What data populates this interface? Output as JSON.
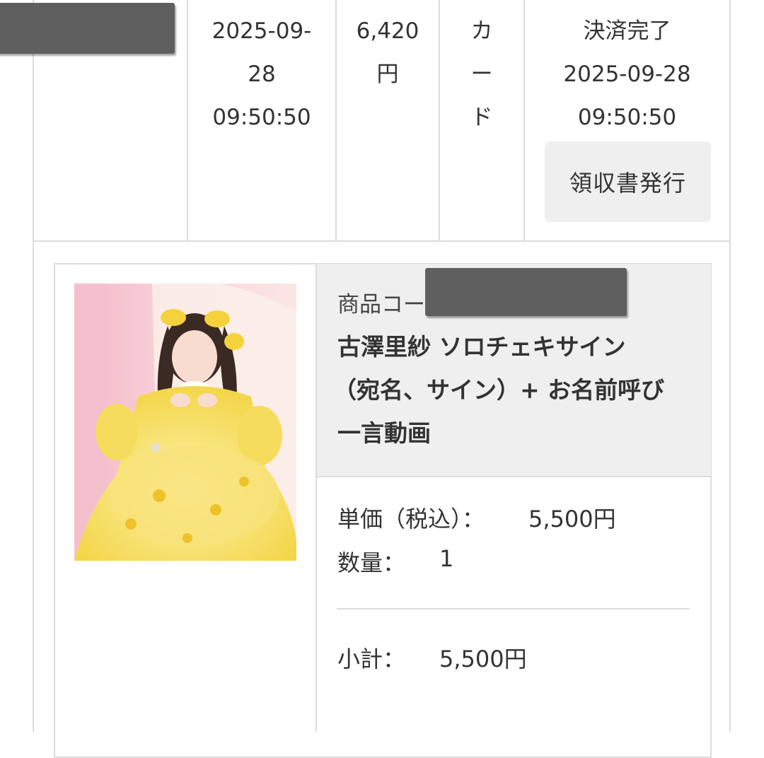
{
  "order_row": {
    "order_datetime_lines": [
      "2025-09-",
      "28",
      "09:50:50"
    ],
    "amount_lines": [
      "6,420",
      "円"
    ],
    "payment_method_lines": [
      "カ",
      "ー",
      "ド"
    ],
    "status_lines": [
      "決済完了",
      "2025-09-28",
      "09:50:50"
    ],
    "receipt_button_label": "領収書発行"
  },
  "product": {
    "image_alt": "商品画像（黄色いドレスの女性）",
    "code_label": "商品コー",
    "title_lines": [
      "古澤里紗 ソロチェキサイン",
      "（宛名、サイン）+ お名前呼び",
      "一言動画"
    ],
    "unit_price_label": "単価（税込）：",
    "unit_price_value": "5,500円",
    "quantity_label": "数量：",
    "quantity_value": "1",
    "subtotal_label": "小計：",
    "subtotal_value": "5,500円"
  },
  "colors": {
    "border": "#dcdcdc",
    "header_bg": "#efefef",
    "redaction": "#5f5f5f",
    "text": "#333333"
  }
}
